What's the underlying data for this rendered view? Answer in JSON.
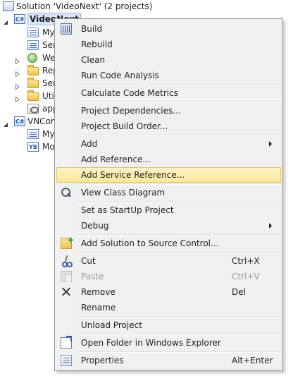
{
  "solution_explorer": {
    "solution_label": "Solution 'VideoNext' (2 projects)",
    "project_1_label": "VideoNext",
    "items": [
      {
        "label": "My"
      },
      {
        "label": "Ser"
      },
      {
        "label": "We"
      },
      {
        "label": "Rep"
      },
      {
        "label": "Ser"
      },
      {
        "label": "Util"
      },
      {
        "label": "app"
      }
    ],
    "project_2_label": "VNCor",
    "project_2_items": [
      {
        "label": "My"
      },
      {
        "label": "Mo"
      }
    ]
  },
  "context_menu": {
    "build": "Build",
    "rebuild": "Rebuild",
    "clean": "Clean",
    "run_code_analysis": "Run Code Analysis",
    "calculate_code_metrics": "Calculate Code Metrics",
    "project_dependencies": "Project Dependencies...",
    "project_build_order": "Project Build Order...",
    "add": "Add",
    "add_reference": "Add Reference...",
    "add_service_reference": "Add Service Reference...",
    "view_class_diagram": "View Class Diagram",
    "set_startup_project": "Set as StartUp Project",
    "debug": "Debug",
    "add_solution_to_source_control": "Add Solution to Source Control...",
    "cut": "Cut",
    "cut_shortcut": "Ctrl+X",
    "paste": "Paste",
    "paste_shortcut": "Ctrl+V",
    "remove": "Remove",
    "remove_shortcut": "Del",
    "rename": "Rename",
    "unload_project": "Unload Project",
    "open_folder": "Open Folder in Windows Explorer",
    "properties": "Properties",
    "properties_shortcut": "Alt+Enter"
  },
  "colors": {
    "menu_background": "#f0f0f0",
    "hover_background": "#fde79b",
    "hover_border": "#e5c365",
    "selection_background": "#d6e4f5",
    "disabled_text": "#9a9a9a"
  }
}
